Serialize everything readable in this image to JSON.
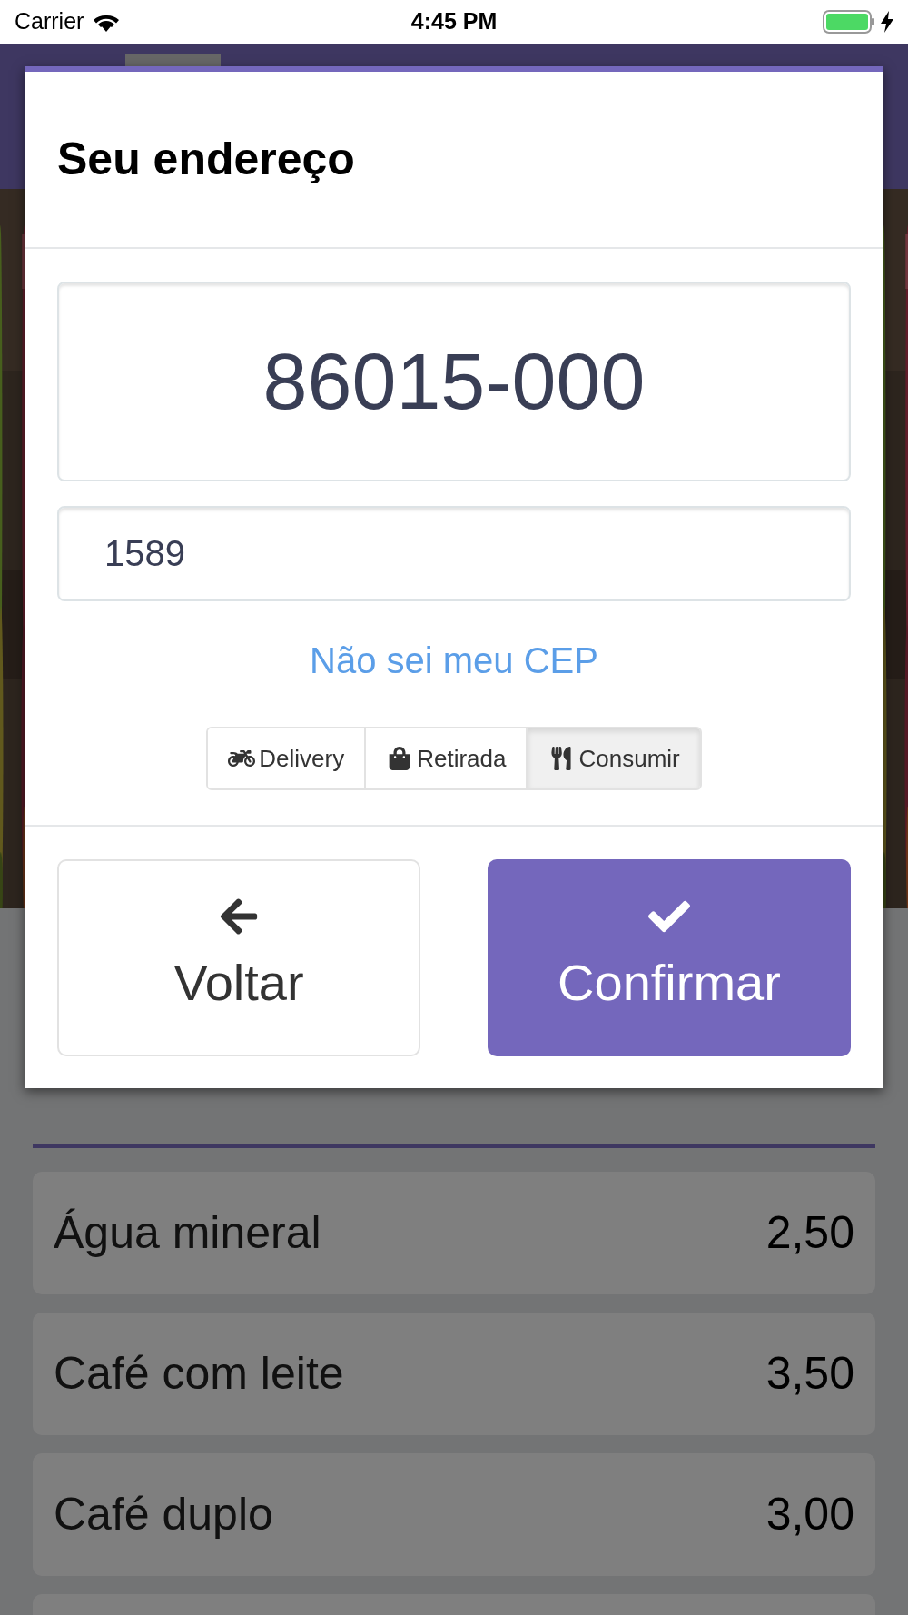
{
  "status_bar": {
    "carrier": "Carrier",
    "time": "4:45 PM"
  },
  "dialog": {
    "title": "Seu endereço",
    "cep_field": {
      "value": "86015-000"
    },
    "number_field": {
      "value": "1589"
    },
    "link": "Não sei meu CEP",
    "modes": [
      {
        "kind": "delivery",
        "label": "Delivery",
        "selected": false
      },
      {
        "kind": "pickup",
        "label": "Retirada",
        "selected": false
      },
      {
        "kind": "dine_in",
        "label": "Consumir",
        "selected": true
      }
    ],
    "buttons": [
      {
        "kind": "back",
        "label": "Voltar"
      },
      {
        "kind": "confirm",
        "label": "Confirmar"
      }
    ]
  },
  "menu": {
    "items": [
      {
        "name": "Água mineral",
        "price": "2,50"
      },
      {
        "name": "Café com leite",
        "price": "3,50"
      },
      {
        "name": "Café duplo",
        "price": "3,00"
      }
    ]
  }
}
